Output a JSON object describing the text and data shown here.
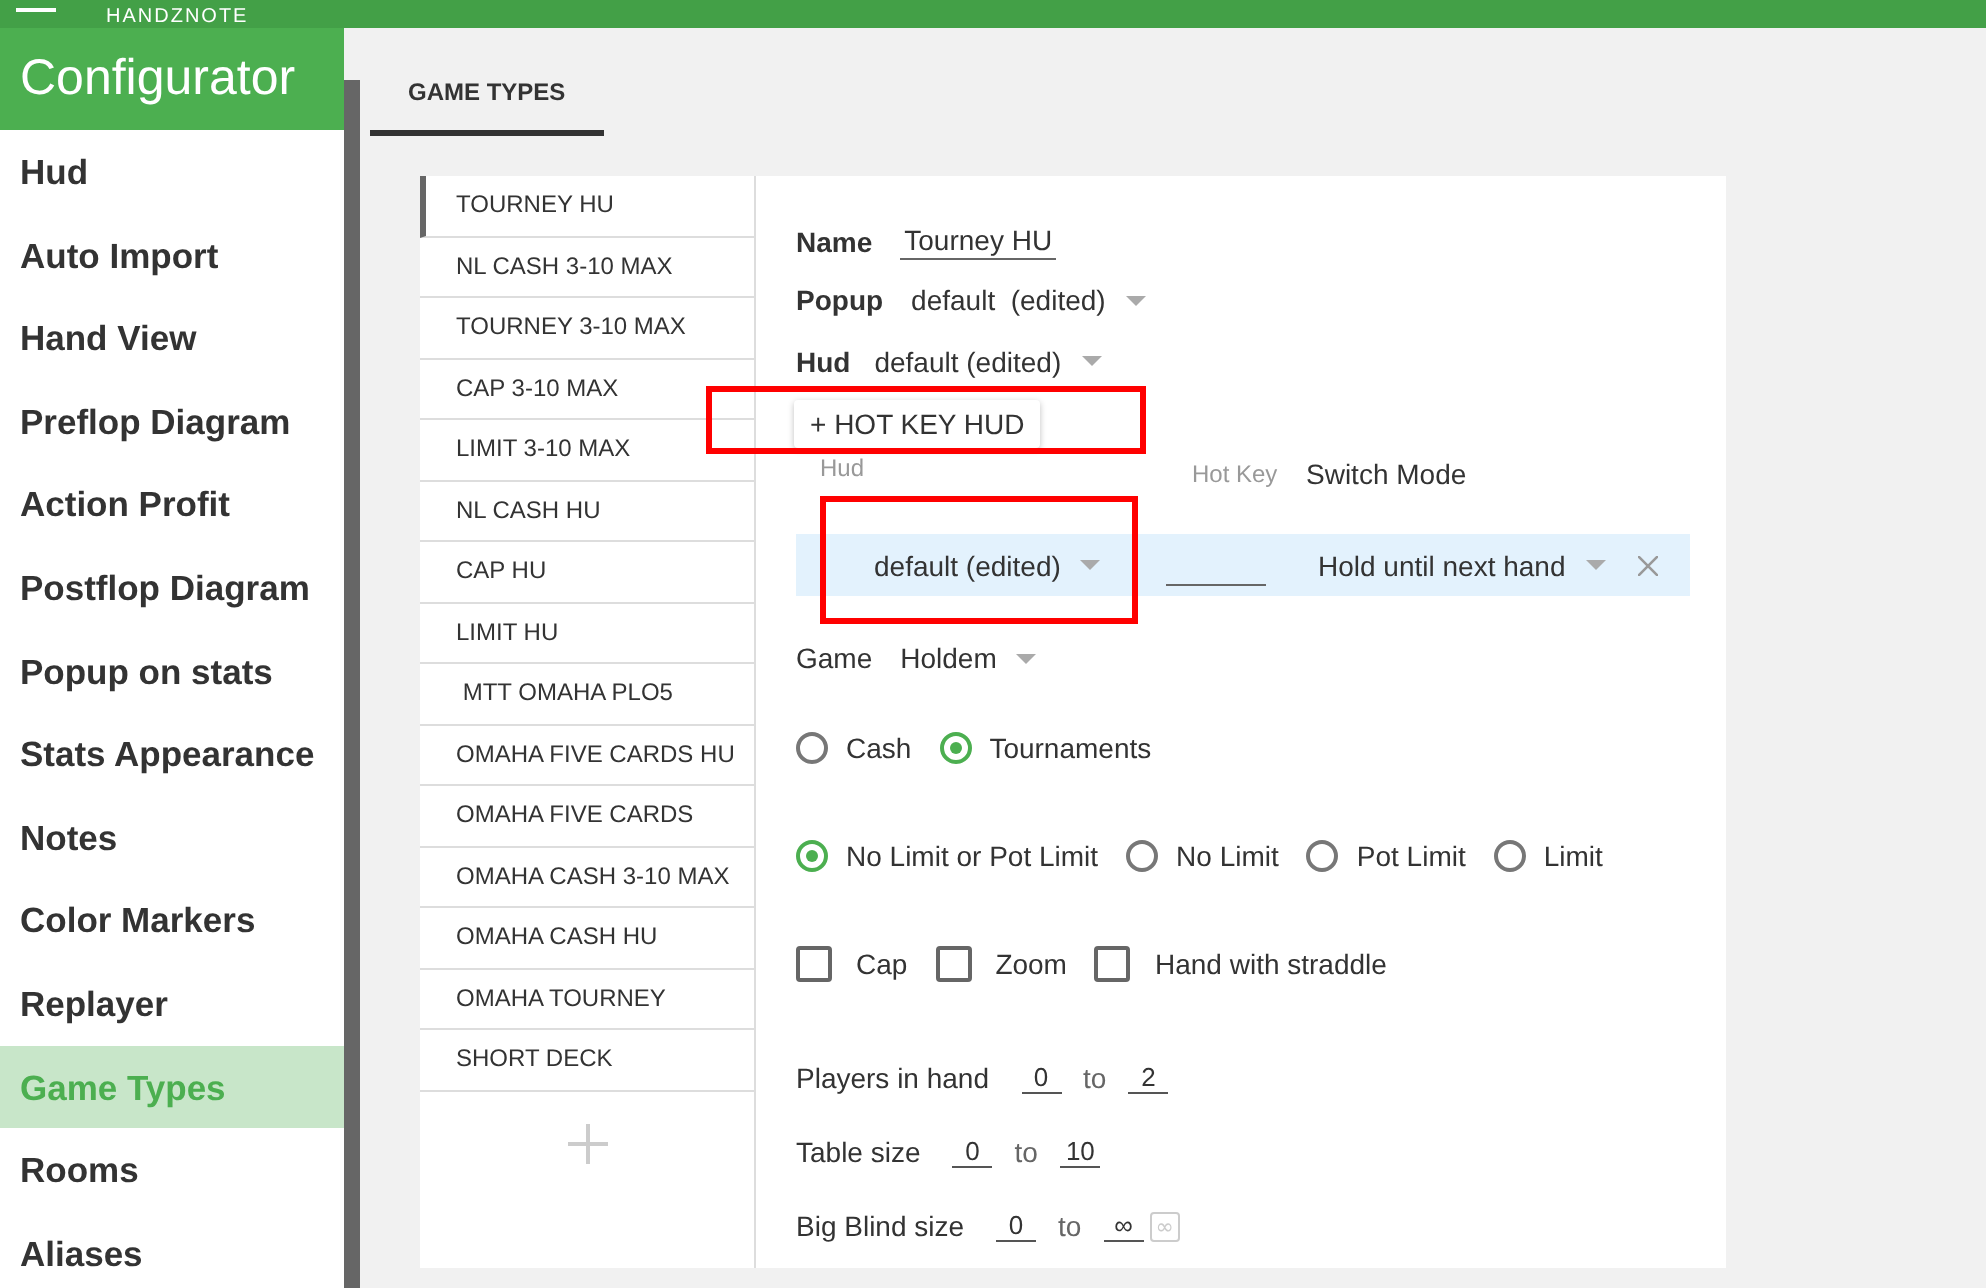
{
  "app": {
    "title": "HANDZNOTE"
  },
  "sidebar": {
    "title": "Configurator",
    "items": [
      {
        "label": "Hud",
        "selected": false
      },
      {
        "label": "Auto Import",
        "selected": false
      },
      {
        "label": "Hand View",
        "selected": false
      },
      {
        "label": "Preflop Diagram",
        "selected": false
      },
      {
        "label": "Action Profit",
        "selected": false
      },
      {
        "label": "Postflop Diagram",
        "selected": false
      },
      {
        "label": "Popup on stats",
        "selected": false
      },
      {
        "label": "Stats Appearance",
        "selected": false
      },
      {
        "label": "Notes",
        "selected": false
      },
      {
        "label": "Color Markers",
        "selected": false
      },
      {
        "label": "Replayer",
        "selected": false
      },
      {
        "label": "Game Types",
        "selected": true
      },
      {
        "label": "Rooms",
        "selected": false
      },
      {
        "label": "Aliases",
        "selected": false
      }
    ]
  },
  "tabs": [
    {
      "label": "GAME TYPES",
      "selected": true
    }
  ],
  "game_types": [
    {
      "label": "TOURNEY HU",
      "selected": true
    },
    {
      "label": "NL CASH 3-10 MAX",
      "selected": false
    },
    {
      "label": "TOURNEY 3-10 MAX",
      "selected": false
    },
    {
      "label": "CAP 3-10 MAX",
      "selected": false
    },
    {
      "label": "LIMIT 3-10 MAX",
      "selected": false
    },
    {
      "label": "NL CASH HU",
      "selected": false
    },
    {
      "label": "CAP HU",
      "selected": false
    },
    {
      "label": "LIMIT HU",
      "selected": false
    },
    {
      "label": " MTT OMAHA PLO5",
      "selected": false
    },
    {
      "label": "OMAHA FIVE CARDS HU",
      "selected": false
    },
    {
      "label": "OMAHA FIVE CARDS",
      "selected": false
    },
    {
      "label": "OMAHA CASH 3-10 MAX",
      "selected": false
    },
    {
      "label": "OMAHA CASH HU",
      "selected": false
    },
    {
      "label": "OMAHA TOURNEY",
      "selected": false
    },
    {
      "label": "SHORT DECK",
      "selected": false
    }
  ],
  "form": {
    "name": {
      "label": "Name",
      "value": "Tourney HU"
    },
    "popup": {
      "label": "Popup",
      "value": "default  (edited)"
    },
    "hud": {
      "label": "Hud",
      "value": "default (edited)"
    },
    "hotkey_button": "+ HOT KEY HUD",
    "hotkeys": {
      "columns": [
        {
          "label": "Hud",
          "dimmed": true
        },
        {
          "label": "Hot Key",
          "dimmed": true
        },
        {
          "label": "Switch Mode",
          "dimmed": false
        }
      ],
      "rows": [
        {
          "hud": "default (edited)",
          "switch_mode": "Hold until next hand"
        }
      ]
    },
    "game": {
      "label": "Game",
      "value": "Holdem"
    },
    "format": [
      {
        "label": "Cash",
        "selected": false
      },
      {
        "label": "Tournaments",
        "selected": true
      }
    ],
    "limit": [
      {
        "label": "No Limit or Pot Limit",
        "selected": true
      },
      {
        "label": "No Limit",
        "selected": false
      },
      {
        "label": "Pot Limit",
        "selected": false
      },
      {
        "label": "Limit",
        "selected": false
      }
    ],
    "options": [
      {
        "label": "Cap",
        "checked": false
      },
      {
        "label": "Zoom",
        "checked": false
      },
      {
        "label": "Hand with straddle",
        "checked": false
      }
    ],
    "ranges": [
      {
        "label": "Players in hand",
        "from": "0",
        "sep": "to",
        "to": "2"
      },
      {
        "label": "Table size",
        "from": "0",
        "sep": "to",
        "to": "10"
      },
      {
        "label": "Big Blind size",
        "from": "0",
        "sep": "to",
        "to": "∞",
        "button": "∞"
      }
    ]
  }
}
